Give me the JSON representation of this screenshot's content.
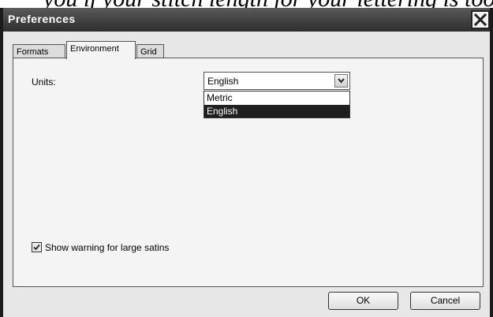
{
  "background_text": "you if your stitch length for your lettering is too",
  "window": {
    "title": "Preferences",
    "close_icon": "close-icon"
  },
  "tabs": [
    {
      "label": "Formats",
      "active": false
    },
    {
      "label": "Environment",
      "active": true
    },
    {
      "label": "Grid",
      "active": false
    }
  ],
  "environment": {
    "units_label": "Units:",
    "units_selected": "English",
    "units_options": [
      "Metric",
      "English"
    ],
    "units_highlighted": "English",
    "show_warning_label": "Show warning for large satins",
    "show_warning_checked": true
  },
  "buttons": {
    "ok": "OK",
    "cancel": "Cancel"
  }
}
